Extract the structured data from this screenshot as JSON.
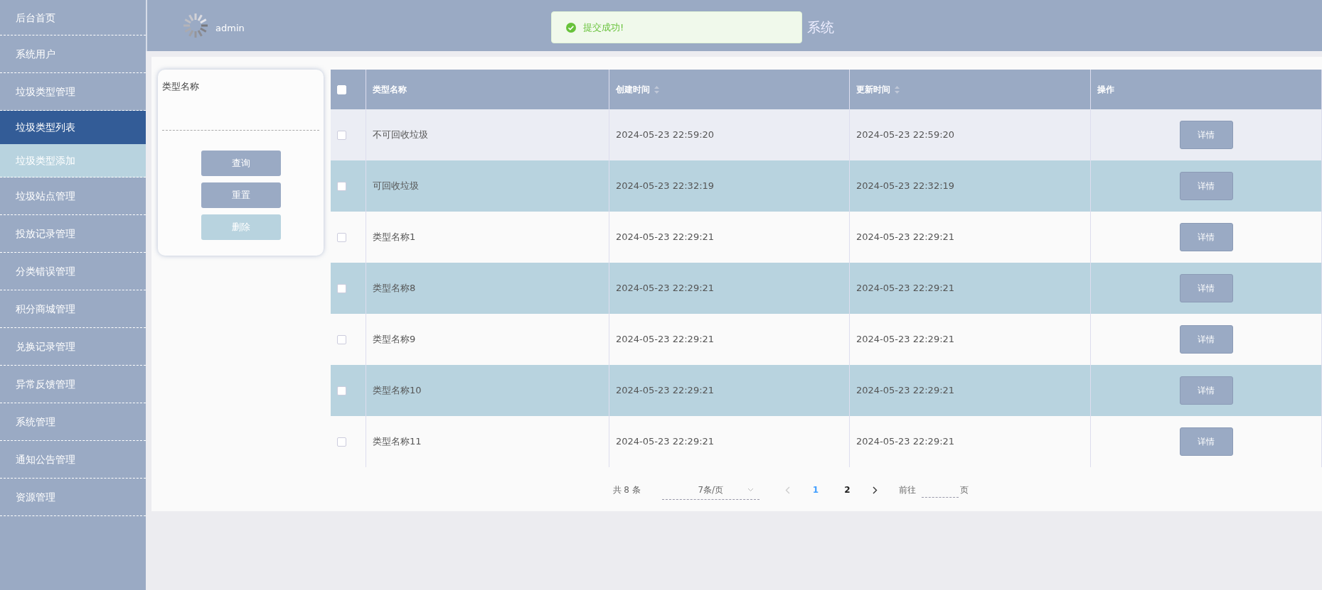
{
  "header": {
    "user": "admin",
    "title": "系统"
  },
  "toast": {
    "message": "提交成功!"
  },
  "sidebar": {
    "items": [
      {
        "label": "后台首页",
        "selected": false
      },
      {
        "label": "系统用户",
        "selected": false
      },
      {
        "label": "垃圾类型管理",
        "selected": false,
        "children": [
          {
            "label": "垃圾类型列表",
            "selected": true
          },
          {
            "label": "垃圾类型添加",
            "selected": false
          }
        ]
      },
      {
        "label": "垃圾站点管理",
        "selected": false
      },
      {
        "label": "投放记录管理",
        "selected": false
      },
      {
        "label": "分类错误管理",
        "selected": false
      },
      {
        "label": "积分商城管理",
        "selected": false
      },
      {
        "label": "兑换记录管理",
        "selected": false
      },
      {
        "label": "异常反馈管理",
        "selected": false
      },
      {
        "label": "系统管理",
        "selected": false
      },
      {
        "label": "通知公告管理",
        "selected": false
      },
      {
        "label": "资源管理",
        "selected": false
      }
    ]
  },
  "search": {
    "label": "类型名称",
    "buttons": [
      {
        "label": "查询",
        "disabled": false
      },
      {
        "label": "重置",
        "disabled": false
      },
      {
        "label": "删除",
        "disabled": true
      }
    ]
  },
  "table": {
    "header_checked": false,
    "columns": [
      {
        "label": "类型名称",
        "sortable": false
      },
      {
        "label": "创建时间",
        "sortable": true
      },
      {
        "label": "更新时间",
        "sortable": true
      },
      {
        "label": "操作",
        "sortable": false
      }
    ],
    "rows": [
      {
        "checked": false,
        "hovered": true,
        "name": "不可回收垃圾",
        "created": "2024-05-23 22:59:20",
        "updated": "2024-05-23 22:59:20",
        "action": "详情"
      },
      {
        "checked": false,
        "hovered": false,
        "name": "可回收垃圾",
        "created": "2024-05-23 22:32:19",
        "updated": "2024-05-23 22:32:19",
        "action": "详情"
      },
      {
        "checked": false,
        "hovered": false,
        "name": "类型名称1",
        "created": "2024-05-23 22:29:21",
        "updated": "2024-05-23 22:29:21",
        "action": "详情"
      },
      {
        "checked": false,
        "hovered": false,
        "name": "类型名称8",
        "created": "2024-05-23 22:29:21",
        "updated": "2024-05-23 22:29:21",
        "action": "详情"
      },
      {
        "checked": false,
        "hovered": false,
        "name": "类型名称9",
        "created": "2024-05-23 22:29:21",
        "updated": "2024-05-23 22:29:21",
        "action": "详情"
      },
      {
        "checked": false,
        "hovered": false,
        "name": "类型名称10",
        "created": "2024-05-23 22:29:21",
        "updated": "2024-05-23 22:29:21",
        "action": "详情"
      },
      {
        "checked": false,
        "hovered": false,
        "name": "类型名称11",
        "created": "2024-05-23 22:29:21",
        "updated": "2024-05-23 22:29:21",
        "action": "详情"
      }
    ]
  },
  "pagination": {
    "total": "共 8 条",
    "page_size": "7条/页",
    "prev_disabled": true,
    "pages": [
      {
        "label": "1",
        "selected": true
      },
      {
        "label": "2",
        "selected": false
      }
    ],
    "goto_label": "前往",
    "goto_suffix": "页"
  }
}
